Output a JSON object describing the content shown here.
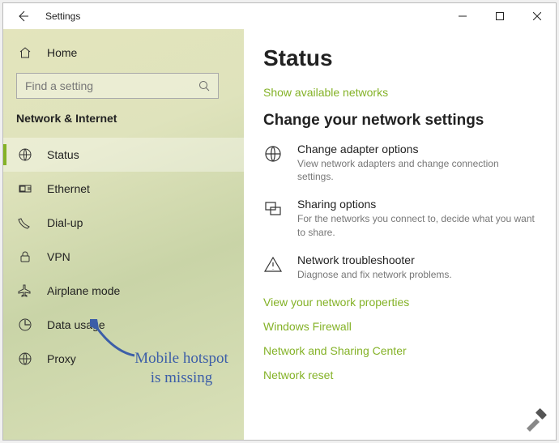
{
  "titlebar": {
    "title": "Settings"
  },
  "sidebar": {
    "home": "Home",
    "search_placeholder": "Find a setting",
    "category": "Network & Internet",
    "items": [
      {
        "label": "Status"
      },
      {
        "label": "Ethernet"
      },
      {
        "label": "Dial-up"
      },
      {
        "label": "VPN"
      },
      {
        "label": "Airplane mode"
      },
      {
        "label": "Data usage"
      },
      {
        "label": "Proxy"
      }
    ]
  },
  "content": {
    "heading": "Status",
    "show_networks": "Show available networks",
    "change_heading": "Change your network settings",
    "options": [
      {
        "title": "Change adapter options",
        "desc": "View network adapters and change connection settings."
      },
      {
        "title": "Sharing options",
        "desc": "For the networks you connect to, decide what you want to share."
      },
      {
        "title": "Network troubleshooter",
        "desc": "Diagnose and fix network problems."
      }
    ],
    "links": [
      "View your network properties",
      "Windows Firewall",
      "Network and Sharing Center",
      "Network reset"
    ]
  },
  "annotation": "Mobile hotspot is missing"
}
